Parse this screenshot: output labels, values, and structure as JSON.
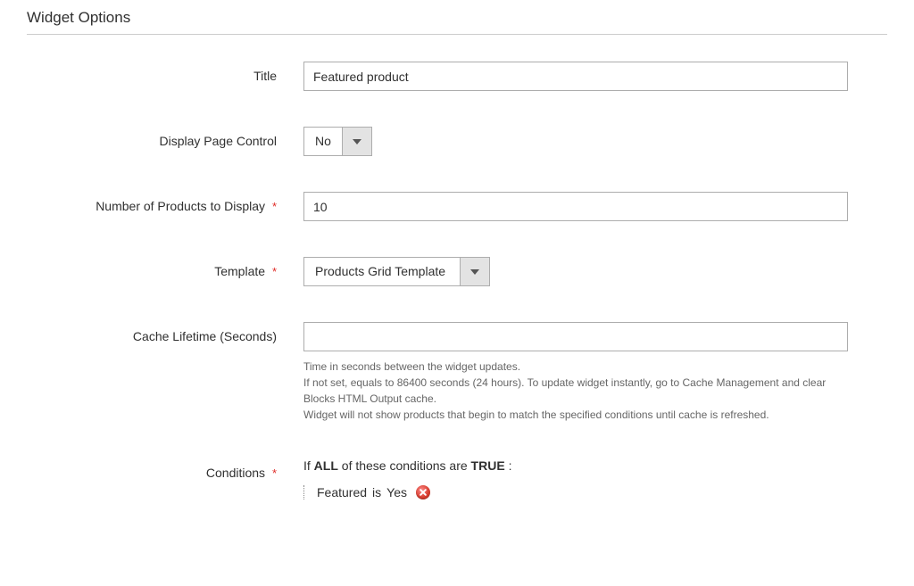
{
  "section": {
    "title": "Widget Options"
  },
  "fields": {
    "title": {
      "label": "Title",
      "value": "Featured product"
    },
    "display_page_control": {
      "label": "Display Page Control",
      "value": "No"
    },
    "num_products": {
      "label": "Number of Products to Display",
      "value": "10",
      "required": true
    },
    "template": {
      "label": "Template",
      "value": "Products Grid Template",
      "required": true
    },
    "cache_lifetime": {
      "label": "Cache Lifetime (Seconds)",
      "value": "",
      "helper_line1": "Time in seconds between the widget updates.",
      "helper_line2": "If not set, equals to 86400 seconds (24 hours). To update widget instantly, go to Cache Management and clear Blocks HTML Output cache.",
      "helper_line3": "Widget will not show products that begin to match the specified conditions until cache is refreshed."
    },
    "conditions": {
      "label": "Conditions",
      "required": true,
      "root_if": "If",
      "root_agg": "ALL",
      "root_mid": "of these conditions are",
      "root_val": "TRUE",
      "root_end": ":",
      "item_attr": "Featured",
      "item_op": "is",
      "item_val": "Yes"
    }
  },
  "glyphs": {
    "asterisk": "*"
  }
}
